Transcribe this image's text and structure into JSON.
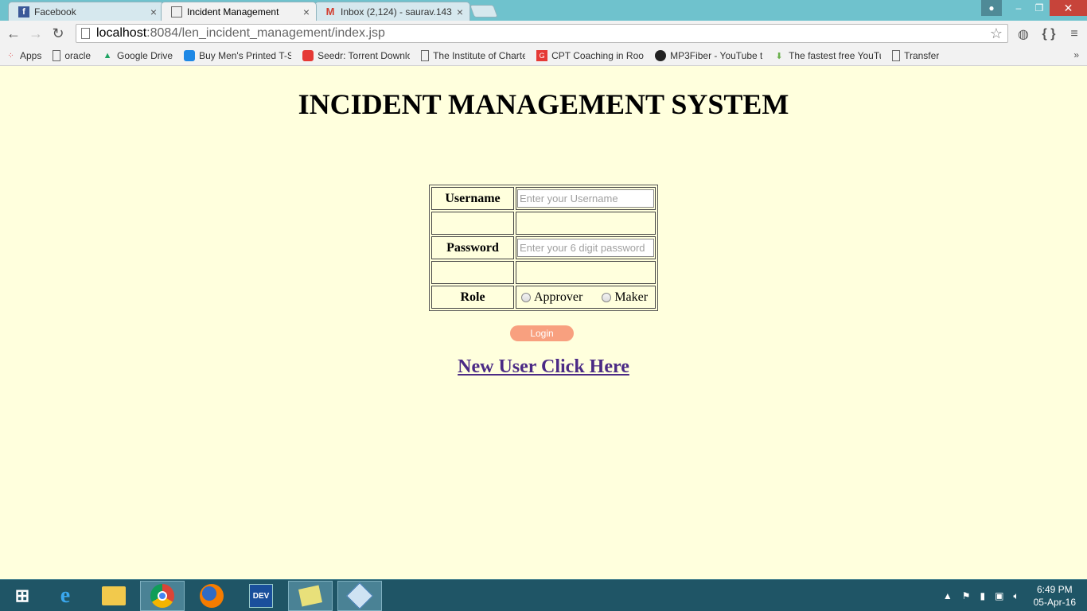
{
  "browser": {
    "tabs": [
      {
        "title": "Facebook",
        "icon": "facebook-icon",
        "active": false
      },
      {
        "title": "Incident Management",
        "icon": "page-icon",
        "active": true
      },
      {
        "title": "Inbox (2,124) - saurav.143",
        "icon": "gmail-icon",
        "active": false
      }
    ],
    "url_host": "localhost",
    "url_rest": ":8084/len_incident_management/index.jsp",
    "bookmarks": [
      {
        "label": "Apps",
        "icon": "apps-grid-icon"
      },
      {
        "label": "oracle",
        "icon": "page-icon"
      },
      {
        "label": "Google Drive",
        "icon": "google-drive-icon"
      },
      {
        "label": "Buy Men's Printed T-S",
        "icon": "shop-icon"
      },
      {
        "label": "Seedr: Torrent Downlo",
        "icon": "seedr-icon"
      },
      {
        "label": "The Institute of Charte",
        "icon": "page-icon"
      },
      {
        "label": "CPT Coaching in Roor",
        "icon": "cpt-icon"
      },
      {
        "label": "MP3Fiber - YouTube t",
        "icon": "mp3fiber-icon"
      },
      {
        "label": "The fastest free YouTu",
        "icon": "download-arrow-icon"
      },
      {
        "label": "Transfer",
        "icon": "page-icon"
      }
    ]
  },
  "page": {
    "title": "INCIDENT MANAGEMENT SYSTEM",
    "username_label": "Username",
    "username_placeholder": "Enter your Username",
    "password_label": "Password",
    "password_placeholder": "Enter your 6 digit password",
    "role_label": "Role",
    "role_options": [
      "Approver",
      "Maker"
    ],
    "login_button": "Login",
    "new_user_link": "New User Click Here",
    "colors": {
      "background": "#ffffdd",
      "login_button": "#f8a07f",
      "link": "#4b2a85"
    }
  },
  "taskbar": {
    "time": "6:49 PM",
    "date": "05-Apr-16"
  }
}
